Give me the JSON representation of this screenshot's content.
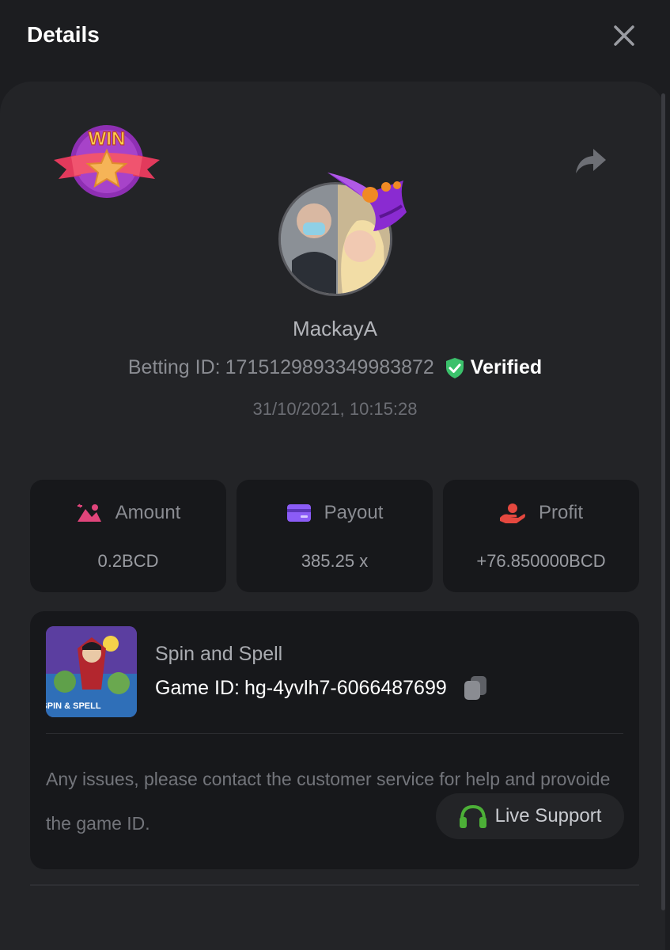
{
  "header": {
    "title": "Details"
  },
  "badge": {
    "text": "WIN"
  },
  "player": {
    "username": "MackayA",
    "betting_id_label": "Betting ID:",
    "betting_id": "1715129893349983872",
    "verified_label": "Verified",
    "timestamp": "31/10/2021, 10:15:28"
  },
  "stats": {
    "amount": {
      "label": "Amount",
      "value": "0.2BCD",
      "icon": "amount-icon",
      "color": "#e0457b"
    },
    "payout": {
      "label": "Payout",
      "value": "385.25 x",
      "icon": "card-icon",
      "color": "#8b5cf6"
    },
    "profit": {
      "label": "Profit",
      "value": "+76.850000BCD",
      "icon": "hand-coin-icon",
      "color": "#e5483f"
    }
  },
  "game": {
    "thumb_text": "SPIN & SPELL",
    "name": "Spin and Spell",
    "id_label": "Game ID:",
    "id_value": "hg-4yvlh7-6066487699",
    "notice": "Any issues, please contact the customer service for help and provoide the game ID.",
    "support_label": "Live Support"
  },
  "colors": {
    "background": "#1c1d20",
    "card": "#232427",
    "panel": "#17181b",
    "verified_green": "#3bc16b",
    "support_green": "#4caf37"
  }
}
